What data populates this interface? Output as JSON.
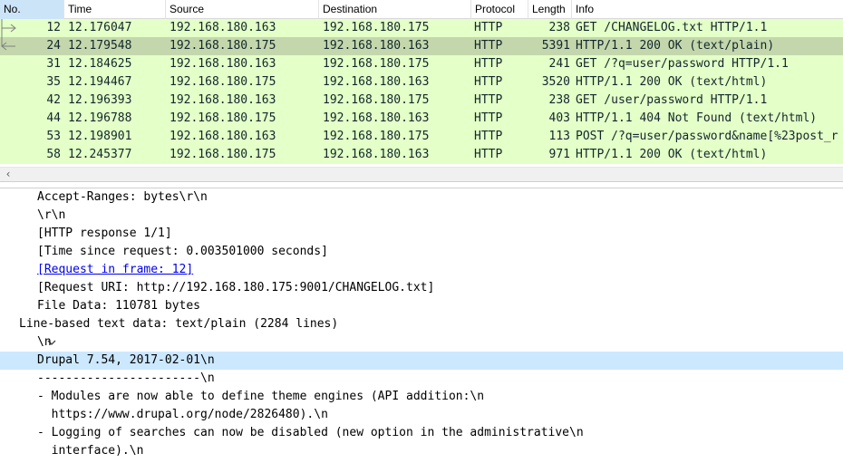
{
  "packet_list": {
    "columns": [
      "No.",
      "Time",
      "Source",
      "Destination",
      "Protocol",
      "Length",
      "Info"
    ],
    "rows": [
      {
        "no": "12",
        "time": "12.176047",
        "source": "192.168.180.163",
        "destination": "192.168.180.175",
        "protocol": "HTTP",
        "length": "238",
        "info": "GET /CHANGELOG.txt HTTP/1.1"
      },
      {
        "no": "24",
        "time": "12.179548",
        "source": "192.168.180.175",
        "destination": "192.168.180.163",
        "protocol": "HTTP",
        "length": "5391",
        "info": "HTTP/1.1 200 OK  (text/plain)"
      },
      {
        "no": "31",
        "time": "12.184625",
        "source": "192.168.180.163",
        "destination": "192.168.180.175",
        "protocol": "HTTP",
        "length": "241",
        "info": "GET /?q=user/password HTTP/1.1"
      },
      {
        "no": "35",
        "time": "12.194467",
        "source": "192.168.180.175",
        "destination": "192.168.180.163",
        "protocol": "HTTP",
        "length": "3520",
        "info": "HTTP/1.1 200 OK  (text/html)"
      },
      {
        "no": "42",
        "time": "12.196393",
        "source": "192.168.180.163",
        "destination": "192.168.180.175",
        "protocol": "HTTP",
        "length": "238",
        "info": "GET /user/password HTTP/1.1"
      },
      {
        "no": "44",
        "time": "12.196788",
        "source": "192.168.180.175",
        "destination": "192.168.180.163",
        "protocol": "HTTP",
        "length": "403",
        "info": "HTTP/1.1 404 Not Found  (text/html)"
      },
      {
        "no": "53",
        "time": "12.198901",
        "source": "192.168.180.163",
        "destination": "192.168.180.175",
        "protocol": "HTTP",
        "length": "113",
        "info": "POST /?q=user/password&name[%23post_r"
      },
      {
        "no": "58",
        "time": "12.245377",
        "source": "192.168.180.175",
        "destination": "192.168.180.163",
        "protocol": "HTTP",
        "length": "971",
        "info": "HTTP/1.1 200 OK  (text/html)"
      }
    ],
    "selected_row": 1,
    "row_color": "#e4ffc7",
    "selected_row_color": "#c4d7ac",
    "scroll_left_icon": "chevron-left-icon"
  },
  "details": {
    "lines": [
      "Accept-Ranges: bytes\\r\\n",
      "\\r\\n",
      "[HTTP response 1/1]",
      "[Time since request: 0.003501000 seconds]",
      "[Request in frame: 12]",
      "[Request URI: http://192.168.180.175:9001/CHANGELOG.txt]",
      "File Data: 110781 bytes"
    ],
    "section_title": "Line-based text data: text/plain (2284 lines)",
    "section_lines": [
      "\\n",
      "Drupal 7.54, 2017-02-01\\n",
      "-----------------------\\n",
      "- Modules are now able to define theme engines (API addition:\\n",
      "  https://www.drupal.org/node/2826480).\\n",
      "- Logging of searches can now be disabled (new option in the administrative\\n",
      "  interface).\\n"
    ],
    "selected_line_color": "#cce8ff",
    "link_color": "#0000ee",
    "expand_icon": "chevron-down-icon"
  }
}
